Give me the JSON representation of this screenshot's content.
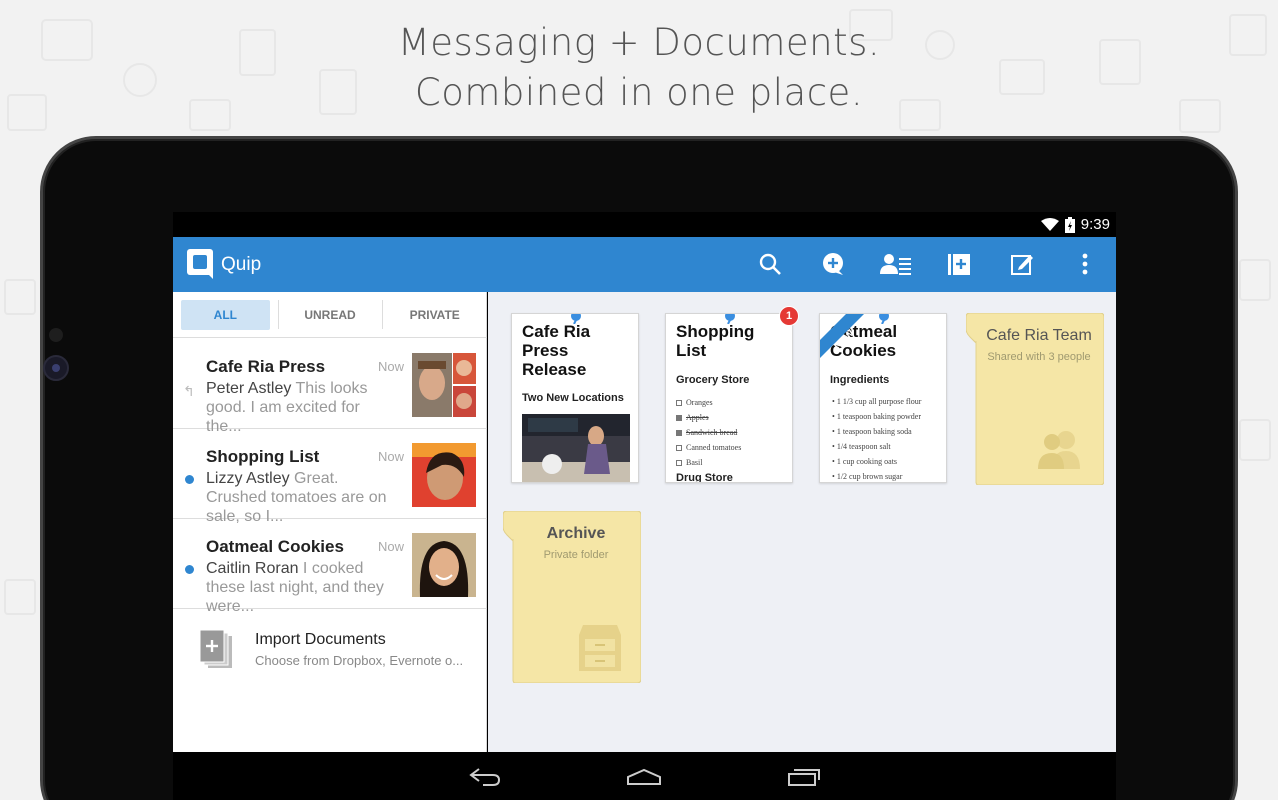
{
  "headline": {
    "line1": "Messaging + Documents.",
    "line2": "Combined in one place."
  },
  "status_bar": {
    "time": "9:39",
    "icons": [
      "wifi-icon",
      "battery-icon"
    ]
  },
  "app_bar": {
    "title": "Quip",
    "accent_color": "#2f86d0",
    "actions": [
      "search-icon",
      "new-message-icon",
      "contacts-icon",
      "new-folder-icon",
      "compose-icon",
      "overflow-menu-icon"
    ]
  },
  "filters": [
    {
      "label": "ALL",
      "active": true
    },
    {
      "label": "UNREAD",
      "active": false
    },
    {
      "label": "PRIVATE",
      "active": false
    }
  ],
  "threads": [
    {
      "title": "Cafe Ria Press",
      "time": "Now",
      "author": "Peter Astley",
      "preview": " This looks good. I am excited for the...",
      "indicator": "reply"
    },
    {
      "title": "Shopping List",
      "time": "Now",
      "author": "Lizzy Astley",
      "preview": " Great. Crushed tomatoes are on sale, so I...",
      "indicator": "unread"
    },
    {
      "title": "Oatmeal Cookies",
      "time": "Now",
      "author": "Caitlin Roran",
      "preview": " I cooked these last night, and they were...",
      "indicator": "unread"
    }
  ],
  "import": {
    "title": "Import Documents",
    "subtitle": "Choose from Dropbox, Evernote o..."
  },
  "documents": [
    {
      "title": "Cafe Ria Press Release",
      "subtitle": "Two New Locations"
    },
    {
      "title": "Shopping List",
      "subtitle": "Grocery Store",
      "badge": "1",
      "items": [
        "Oranges",
        "Apples",
        "Sandwich bread",
        "Canned tomatoes",
        "Basil"
      ],
      "cutoff": "Drug Store"
    },
    {
      "title": "Oatmeal Cookies",
      "ribbon": "NEW",
      "subtitle": "Ingredients",
      "items": [
        "1 1/3 cup all purpose flour",
        "1 teaspoon baking powder",
        "1 teaspoon baking soda",
        "1/4 teaspoon salt",
        "1 cup cooking oats",
        "1/2 cup brown sugar"
      ]
    }
  ],
  "folders": [
    {
      "title": "Cafe Ria Team",
      "subtitle": "Shared with 3 people",
      "icon": "people-icon"
    },
    {
      "title": "Archive",
      "subtitle": "Private folder",
      "icon": "archive-cabinet-icon"
    }
  ],
  "nav_bar": [
    "back-icon",
    "home-icon",
    "recents-icon"
  ]
}
